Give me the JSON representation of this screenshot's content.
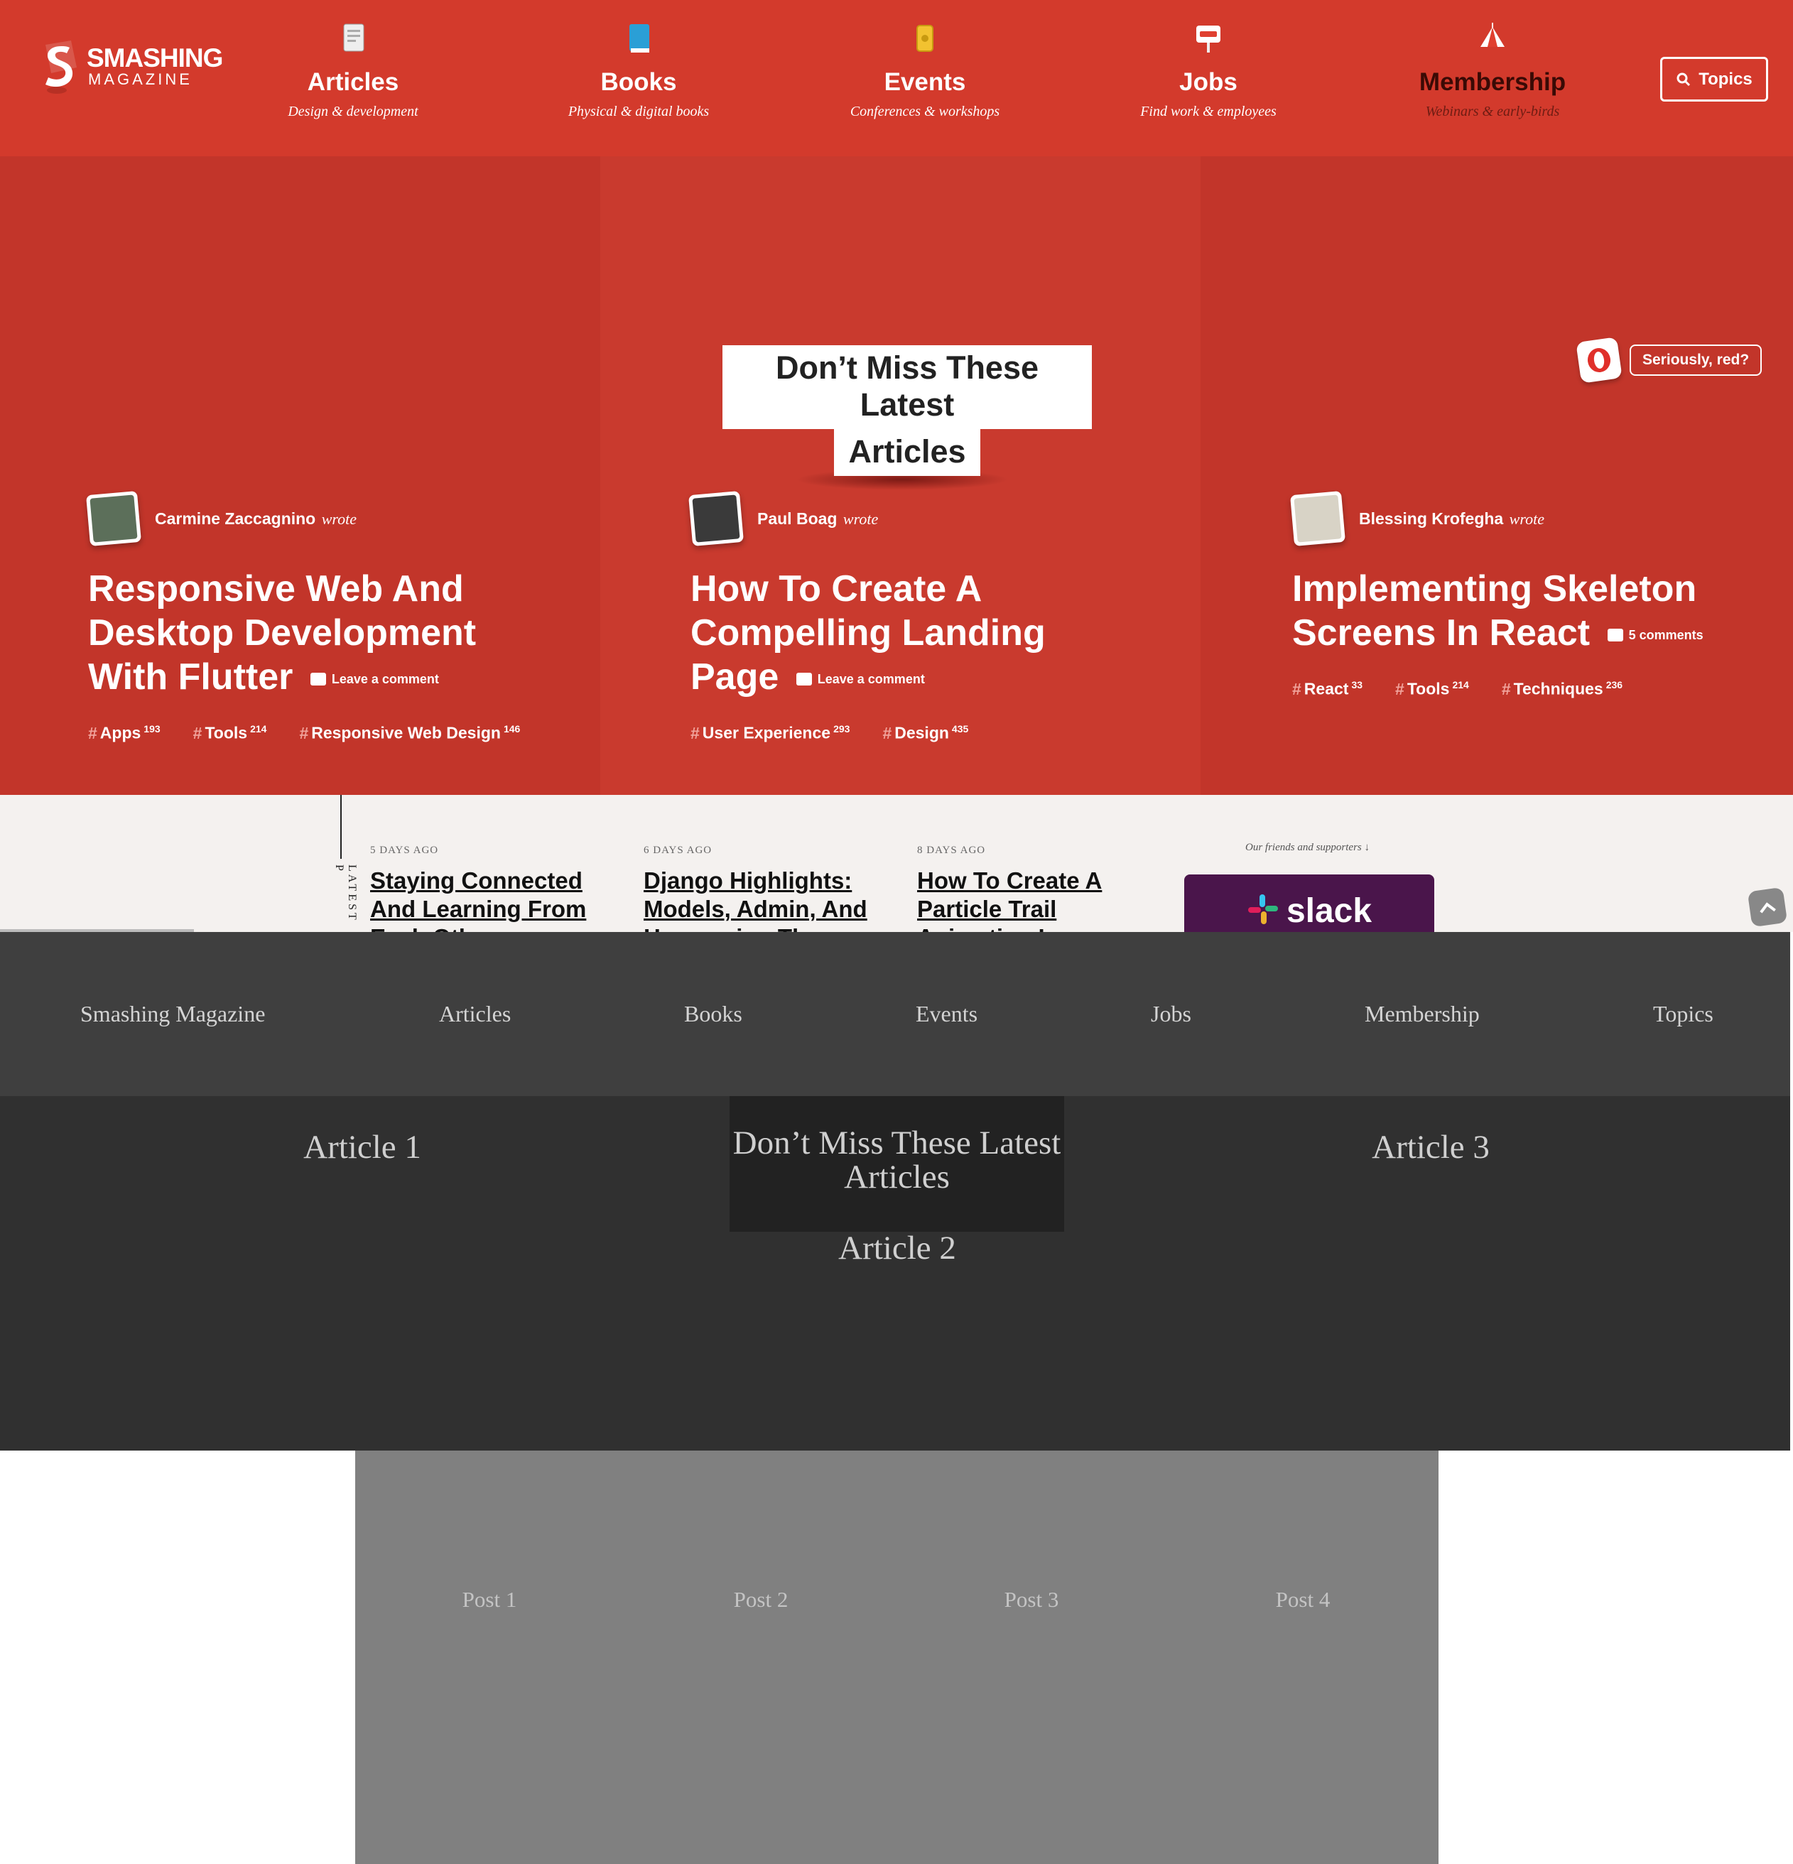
{
  "topnav": {
    "logo": {
      "word1": "SMASHING",
      "word2": "MAGAZINE"
    },
    "items": [
      {
        "label": "Articles",
        "sub": "Design & development",
        "icon": "document-icon"
      },
      {
        "label": "Books",
        "sub": "Physical & digital books",
        "icon": "book-icon"
      },
      {
        "label": "Events",
        "sub": "Conferences & workshops",
        "icon": "ticket-icon"
      },
      {
        "label": "Jobs",
        "sub": "Find work & employees",
        "icon": "open-sign-icon"
      },
      {
        "label": "Membership",
        "sub": "Webinars & early-birds",
        "icon": "circus-tent-icon"
      }
    ],
    "topics_button": "Topics"
  },
  "hero": {
    "heading_line1": "Don’t Miss These Latest",
    "heading_line2": "Articles",
    "seriously_button": "Seriously, red?",
    "articles": [
      {
        "author": "Carmine Zaccagnino",
        "wrote": "wrote",
        "title": "Responsive Web And Desktop Development With Flutter",
        "comment": "Leave a comment",
        "tags": [
          {
            "name": "Apps",
            "count": "193"
          },
          {
            "name": "Tools",
            "count": "214"
          },
          {
            "name": "Responsive Web Design",
            "count": "146"
          }
        ]
      },
      {
        "author": "Paul Boag",
        "wrote": "wrote",
        "title": "How To Create A Compelling Landing Page",
        "comment": "Leave a comment",
        "tags": [
          {
            "name": "User Experience",
            "count": "293"
          },
          {
            "name": "Design",
            "count": "435"
          }
        ]
      },
      {
        "author": "Blessing Krofegha",
        "wrote": "wrote",
        "title": "Implementing Skeleton Screens In React",
        "comment": "5 comments",
        "tags": [
          {
            "name": "React",
            "count": "33"
          },
          {
            "name": "Tools",
            "count": "214"
          },
          {
            "name": "Techniques",
            "count": "236"
          }
        ]
      }
    ],
    "arrow": "⟶"
  },
  "latest": {
    "label": "LATEST P",
    "items": [
      {
        "age": "5 DAYS AGO",
        "title": "Staying Connected And Learning From Each Other"
      },
      {
        "age": "6 DAYS AGO",
        "title": "Django Highlights: Models, Admin, And Harnessing The"
      },
      {
        "age": "8 DAYS AGO",
        "title": "How To Create A Particle Trail Animation In"
      }
    ],
    "friends": "Our friends and supporters ↓",
    "sponsor": "slack"
  },
  "secnav": {
    "items": [
      "Smashing Magazine",
      "Articles",
      "Books",
      "Events",
      "Jobs",
      "Membership",
      "Topics"
    ]
  },
  "articles_placeholder": {
    "article1": "Article 1",
    "article2": "Article 2",
    "article3": "Article 3",
    "dont_miss": "Don’t Miss These Latest Articles"
  },
  "posts": [
    "Post 1",
    "Post 2",
    "Post 3",
    "Post 4"
  ]
}
